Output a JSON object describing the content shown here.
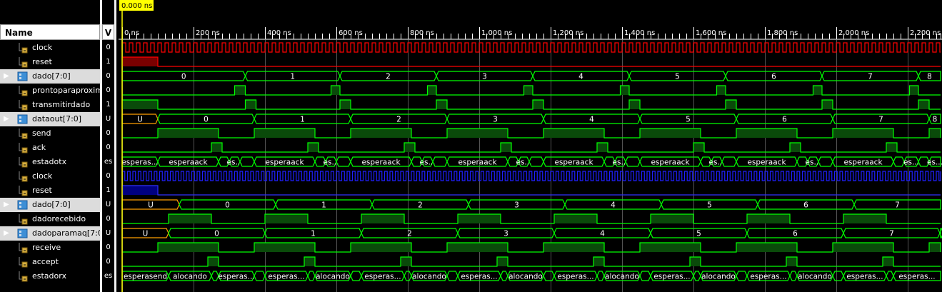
{
  "cursor_label": "0.000 ns",
  "headers": {
    "name": "Name",
    "value": "V"
  },
  "colors": {
    "bit": "#00ff00",
    "bit_fill": "#0a4a0a",
    "bus": "#00ff00",
    "clk": "#ff0000",
    "clk2": "#2020ff",
    "rst": "#ff0000",
    "rst_fill": "#7a0000",
    "rst2": "#3030ff",
    "rst2_fill": "#000080",
    "undef": "#ffa000",
    "text": "#ffffff",
    "cursor": "#ffff00"
  },
  "ticks": [
    {
      "ns": 0,
      "label": "0 ns"
    },
    {
      "ns": 200,
      "label": "200 ns"
    },
    {
      "ns": 400,
      "label": "400 ns"
    },
    {
      "ns": 600,
      "label": "600 ns"
    },
    {
      "ns": 800,
      "label": "800 ns"
    },
    {
      "ns": 1000,
      "label": "1,000 ns"
    },
    {
      "ns": 1200,
      "label": "1,200 ns"
    },
    {
      "ns": 1400,
      "label": "1,400 ns"
    },
    {
      "ns": 1600,
      "label": "1,600 ns"
    },
    {
      "ns": 1800,
      "label": "1,800 ns"
    },
    {
      "ns": 2000,
      "label": "2,000 ns"
    },
    {
      "ns": 2200,
      "label": "2,200 ns"
    }
  ],
  "signals": [
    {
      "name": "clock",
      "value": "0",
      "kind": "clock",
      "color": "clk",
      "period": 20
    },
    {
      "name": "reset",
      "value": "1",
      "kind": "reset",
      "color": "rst",
      "until": 100
    },
    {
      "name": "dado[7:0]",
      "value": "0",
      "kind": "bus",
      "bus": true,
      "segs": [
        [
          0,
          345,
          "0"
        ],
        [
          345,
          610,
          "1"
        ],
        [
          610,
          880,
          "2"
        ],
        [
          880,
          1150,
          "3"
        ],
        [
          1150,
          1420,
          "4"
        ],
        [
          1420,
          1690,
          "5"
        ],
        [
          1690,
          1960,
          "6"
        ],
        [
          1960,
          2230,
          "7"
        ],
        [
          2230,
          2300,
          "8"
        ]
      ]
    },
    {
      "name": "prontoparaproxim",
      "value": "0",
      "kind": "bit",
      "highs": [
        [
          315,
          345
        ],
        [
          585,
          610
        ],
        [
          855,
          880
        ],
        [
          1125,
          1150
        ],
        [
          1395,
          1420
        ],
        [
          1665,
          1690
        ],
        [
          1935,
          1960
        ],
        [
          2205,
          2230
        ]
      ]
    },
    {
      "name": "transmitirdado",
      "value": "1",
      "kind": "bit",
      "highs": [
        [
          0,
          100
        ],
        [
          345,
          375
        ],
        [
          610,
          640
        ],
        [
          880,
          910
        ],
        [
          1150,
          1180
        ],
        [
          1420,
          1450
        ],
        [
          1690,
          1720
        ],
        [
          1960,
          1990
        ],
        [
          2230,
          2260
        ]
      ]
    },
    {
      "name": "dataout[7:0]",
      "value": "U",
      "kind": "bus",
      "bus": true,
      "segs": [
        [
          0,
          100,
          "U"
        ],
        [
          100,
          370,
          "0"
        ],
        [
          370,
          640,
          "1"
        ],
        [
          640,
          910,
          "2"
        ],
        [
          910,
          1180,
          "3"
        ],
        [
          1180,
          1450,
          "4"
        ],
        [
          1450,
          1720,
          "5"
        ],
        [
          1720,
          1990,
          "6"
        ],
        [
          1990,
          2260,
          "7"
        ],
        [
          2260,
          2300,
          "8"
        ]
      ]
    },
    {
      "name": "send",
      "value": "0",
      "kind": "bit",
      "highs": [
        [
          100,
          270
        ],
        [
          370,
          540
        ],
        [
          640,
          810
        ],
        [
          910,
          1080
        ],
        [
          1180,
          1350
        ],
        [
          1450,
          1620
        ],
        [
          1720,
          1890
        ],
        [
          1990,
          2160
        ],
        [
          2260,
          2300
        ]
      ]
    },
    {
      "name": "ack",
      "value": "0",
      "kind": "bit",
      "highs": [
        [
          250,
          280
        ],
        [
          520,
          550
        ],
        [
          790,
          820
        ],
        [
          1060,
          1090
        ],
        [
          1330,
          1360
        ],
        [
          1600,
          1630
        ],
        [
          1870,
          1900
        ],
        [
          2140,
          2170
        ]
      ]
    },
    {
      "name": "estadotx",
      "value": "es",
      "kind": "bus",
      "segs": [
        [
          0,
          100,
          "esperas..."
        ],
        [
          100,
          270,
          "esperaack"
        ],
        [
          270,
          300,
          ""
        ],
        [
          300,
          330,
          "es..."
        ],
        [
          330,
          370,
          ""
        ],
        [
          370,
          540,
          "esperaack"
        ],
        [
          540,
          570,
          ""
        ],
        [
          570,
          600,
          "es..."
        ],
        [
          600,
          640,
          ""
        ],
        [
          640,
          810,
          "esperaack"
        ],
        [
          810,
          840,
          ""
        ],
        [
          840,
          870,
          "es..."
        ],
        [
          870,
          910,
          ""
        ],
        [
          910,
          1080,
          "esperaack"
        ],
        [
          1080,
          1110,
          ""
        ],
        [
          1110,
          1140,
          "es..."
        ],
        [
          1140,
          1180,
          ""
        ],
        [
          1180,
          1350,
          "esperaack"
        ],
        [
          1350,
          1380,
          ""
        ],
        [
          1380,
          1410,
          "es..."
        ],
        [
          1410,
          1450,
          ""
        ],
        [
          1450,
          1620,
          "esperaack"
        ],
        [
          1620,
          1650,
          ""
        ],
        [
          1650,
          1680,
          "es..."
        ],
        [
          1680,
          1720,
          ""
        ],
        [
          1720,
          1890,
          "esperaack"
        ],
        [
          1890,
          1920,
          ""
        ],
        [
          1920,
          1950,
          "es..."
        ],
        [
          1950,
          1990,
          ""
        ],
        [
          1990,
          2160,
          "esperaack"
        ],
        [
          2160,
          2190,
          ""
        ],
        [
          2190,
          2230,
          "es..."
        ],
        [
          2230,
          2260,
          ""
        ],
        [
          2260,
          2300,
          "es..."
        ]
      ]
    },
    {
      "name": "clock",
      "value": "0",
      "kind": "clock",
      "color": "clk2",
      "period": 15
    },
    {
      "name": "reset",
      "value": "1",
      "kind": "reset",
      "color": "rst2",
      "until": 100
    },
    {
      "name": "dado[7:0]",
      "value": "U",
      "kind": "bus",
      "bus": true,
      "segs": [
        [
          0,
          160,
          "U"
        ],
        [
          160,
          430,
          "0"
        ],
        [
          430,
          700,
          "1"
        ],
        [
          700,
          970,
          "2"
        ],
        [
          970,
          1240,
          "3"
        ],
        [
          1240,
          1510,
          "4"
        ],
        [
          1510,
          1780,
          "5"
        ],
        [
          1780,
          2050,
          "6"
        ],
        [
          2050,
          2300,
          "7"
        ]
      ]
    },
    {
      "name": "dadorecebido",
      "value": "0",
      "kind": "bit",
      "highs": [
        [
          130,
          250
        ],
        [
          400,
          520
        ],
        [
          670,
          790
        ],
        [
          940,
          1060
        ],
        [
          1210,
          1330
        ],
        [
          1480,
          1600
        ],
        [
          1750,
          1870
        ],
        [
          2020,
          2140
        ]
      ]
    },
    {
      "name": "dadoparamaq[7:0]",
      "value": "U",
      "kind": "bus",
      "bus": true,
      "segs": [
        [
          0,
          130,
          "U"
        ],
        [
          130,
          400,
          "0"
        ],
        [
          400,
          670,
          "1"
        ],
        [
          670,
          940,
          "2"
        ],
        [
          940,
          1210,
          "3"
        ],
        [
          1210,
          1480,
          "4"
        ],
        [
          1480,
          1750,
          "5"
        ],
        [
          1750,
          2020,
          "6"
        ],
        [
          2020,
          2290,
          "7"
        ],
        [
          2290,
          2300,
          ""
        ]
      ]
    },
    {
      "name": "receive",
      "value": "0",
      "kind": "bit",
      "highs": [
        [
          100,
          270
        ],
        [
          370,
          540
        ],
        [
          640,
          810
        ],
        [
          910,
          1080
        ],
        [
          1180,
          1350
        ],
        [
          1450,
          1620
        ],
        [
          1720,
          1890
        ],
        [
          1990,
          2160
        ],
        [
          2260,
          2300
        ]
      ]
    },
    {
      "name": "accept",
      "value": "0",
      "kind": "bit",
      "highs": [
        [
          240,
          270
        ],
        [
          510,
          540
        ],
        [
          780,
          810
        ],
        [
          1050,
          1080
        ],
        [
          1320,
          1350
        ],
        [
          1590,
          1620
        ],
        [
          1860,
          1890
        ],
        [
          2130,
          2160
        ]
      ]
    },
    {
      "name": "estadorx",
      "value": "es",
      "kind": "bus",
      "segs": [
        [
          0,
          130,
          "esperasend"
        ],
        [
          130,
          250,
          "alocando"
        ],
        [
          250,
          270,
          ""
        ],
        [
          270,
          370,
          "esperas..."
        ],
        [
          370,
          400,
          ""
        ],
        [
          400,
          520,
          "esperas..."
        ],
        [
          520,
          540,
          ""
        ],
        [
          540,
          640,
          "alocando"
        ],
        [
          640,
          670,
          ""
        ],
        [
          670,
          790,
          "esperas..."
        ],
        [
          790,
          810,
          ""
        ],
        [
          810,
          910,
          "alocando"
        ],
        [
          910,
          940,
          ""
        ],
        [
          940,
          1060,
          "esperas..."
        ],
        [
          1060,
          1080,
          ""
        ],
        [
          1080,
          1180,
          "alocando"
        ],
        [
          1180,
          1210,
          ""
        ],
        [
          1210,
          1330,
          "esperas..."
        ],
        [
          1330,
          1350,
          ""
        ],
        [
          1350,
          1450,
          "alocando"
        ],
        [
          1450,
          1480,
          ""
        ],
        [
          1480,
          1600,
          "esperas..."
        ],
        [
          1600,
          1620,
          ""
        ],
        [
          1620,
          1720,
          "alocando"
        ],
        [
          1720,
          1750,
          ""
        ],
        [
          1750,
          1870,
          "esperas..."
        ],
        [
          1870,
          1890,
          ""
        ],
        [
          1890,
          1990,
          "alocando"
        ],
        [
          1990,
          2020,
          ""
        ],
        [
          2020,
          2140,
          "esperas..."
        ],
        [
          2140,
          2160,
          ""
        ],
        [
          2160,
          2300,
          "esperas..."
        ]
      ]
    }
  ]
}
